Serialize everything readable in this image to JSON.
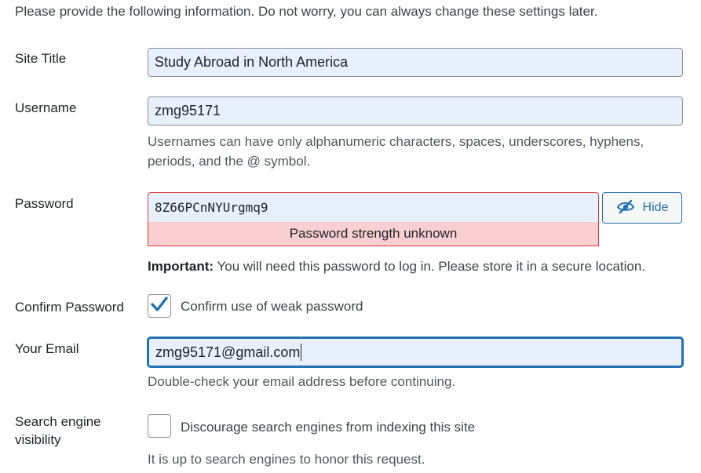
{
  "intro": "Please provide the following information. Do not worry, you can always change these settings later.",
  "site_title": {
    "label": "Site Title",
    "value": "Study Abroad in North America"
  },
  "username": {
    "label": "Username",
    "value": "zmg95171",
    "help_line1": "Usernames can have only alphanumeric characters, spaces, underscores, hyphens,",
    "help_line2": "periods, and the @ symbol."
  },
  "password": {
    "label": "Password",
    "value": "8Z66PCnNYUrgmq9",
    "strength": "Password strength unknown",
    "hide_label": "Hide",
    "important_strong": "Important:",
    "important_text": " You will need this password to log in. Please store it in a secure location."
  },
  "confirm_password": {
    "label": "Confirm Password",
    "checkbox_label": "Confirm use of weak password",
    "checked": true
  },
  "email": {
    "label": "Your Email",
    "value": "zmg95171@gmail.com",
    "help": "Double-check your email address before continuing."
  },
  "search_engine": {
    "label_line1": "Search engine",
    "label_line2": "visibility",
    "checkbox_label": "Discourage search engines from indexing this site",
    "checked": false,
    "help": "It is up to search engines to honor this request."
  },
  "colors": {
    "accent": "#2271b1",
    "error": "#d63638",
    "error_bg": "#facfd2",
    "autofill_bg": "#e8f0fe"
  }
}
